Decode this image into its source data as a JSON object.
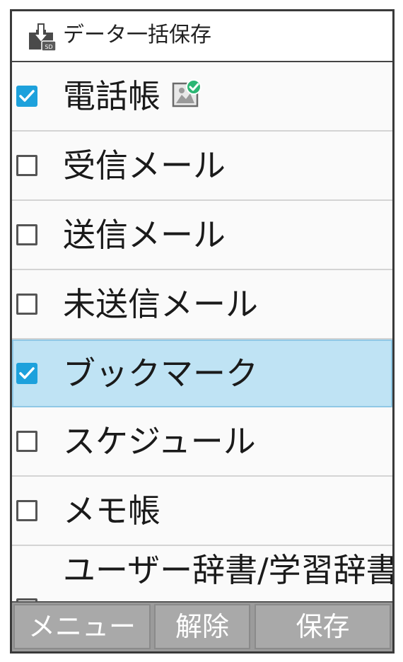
{
  "header": {
    "title": "データ一括保存",
    "icon": "sd-download-icon"
  },
  "items": [
    {
      "label": "電話帳",
      "checked": true,
      "selected": false,
      "badge": "image-check-icon"
    },
    {
      "label": "受信メール",
      "checked": false,
      "selected": false
    },
    {
      "label": "送信メール",
      "checked": false,
      "selected": false
    },
    {
      "label": "未送信メール",
      "checked": false,
      "selected": false
    },
    {
      "label": "ブックマーク",
      "checked": true,
      "selected": true
    },
    {
      "label": "スケジュール",
      "checked": false,
      "selected": false
    },
    {
      "label": "メモ帳",
      "checked": false,
      "selected": false
    },
    {
      "label": "ユーザー辞書/学習辞書",
      "checked": false,
      "selected": false
    }
  ],
  "softkeys": {
    "left": "メニュー",
    "center": "解除",
    "right": "保存"
  },
  "colors": {
    "check_fill": "#1da1dc",
    "selected_row": "#bfe3f4",
    "softkey_bar": "#9b9b9b"
  }
}
